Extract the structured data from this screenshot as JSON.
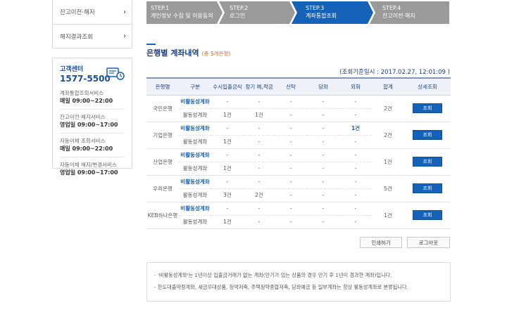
{
  "sidebar": {
    "menu": [
      {
        "label": "잔고이전·해지"
      },
      {
        "label": "해지결과조회"
      }
    ],
    "customer_center": {
      "title": "고객센터",
      "phone": "1577-5500",
      "services": [
        {
          "label": "계좌통합조회서비스",
          "time": "매일 09:00~22:00"
        },
        {
          "label": "잔고이전·해지서비스",
          "time": "영업일 09:00~17:00"
        },
        {
          "label": "자동이체 조회서비스",
          "time": "매일 09:00~22:00"
        },
        {
          "label": "자동이체 해지/변경서비스",
          "time": "영업일 09:00~17:00"
        }
      ]
    }
  },
  "steps": [
    {
      "num": "STEP.1",
      "name": "개인정보 수집 및 이용동의",
      "active": false
    },
    {
      "num": "STEP.2",
      "name": "로그인",
      "active": false
    },
    {
      "num": "STEP.3",
      "name": "계좌통합조회",
      "active": true
    },
    {
      "num": "STEP.4",
      "name": "잔고이전·해지",
      "active": false
    }
  ],
  "page": {
    "title": "은행별 계좌내역",
    "subtitle": "(총 5개은행)",
    "timestamp": "(조회기준일시 : 2017.02.27, 12:01:09 )"
  },
  "table": {
    "headers": [
      "은행명",
      "구분",
      "수시입출금식",
      "정기 예,적금",
      "신탁",
      "당좌",
      "외화",
      "합계",
      "상세조회"
    ],
    "view_label": "조회",
    "banks": [
      {
        "name": "국민은행",
        "total": "2건",
        "rows": [
          {
            "type": "비활동성계좌",
            "inactive": true,
            "cols": [
              "-",
              "-",
              "-",
              "-",
              "-"
            ]
          },
          {
            "type": "활동성계좌",
            "inactive": false,
            "cols": [
              "1건",
              "1건",
              "-",
              "-",
              "-"
            ]
          }
        ]
      },
      {
        "name": "기업은행",
        "total": "2건",
        "rows": [
          {
            "type": "비활동성계좌",
            "inactive": true,
            "cols": [
              "-",
              "-",
              "-",
              "-",
              "1건"
            ]
          },
          {
            "type": "활동성계좌",
            "inactive": false,
            "cols": [
              "1건",
              "-",
              "-",
              "-",
              "-"
            ]
          }
        ]
      },
      {
        "name": "산업은행",
        "total": "1건",
        "rows": [
          {
            "type": "비활동성계좌",
            "inactive": true,
            "cols": [
              "-",
              "-",
              "-",
              "-",
              "-"
            ]
          },
          {
            "type": "활동성계좌",
            "inactive": false,
            "cols": [
              "1건",
              "-",
              "-",
              "-",
              "-"
            ]
          }
        ]
      },
      {
        "name": "우리은행",
        "total": "5건",
        "rows": [
          {
            "type": "비활동성계좌",
            "inactive": true,
            "cols": [
              "-",
              "-",
              "-",
              "-",
              "-"
            ]
          },
          {
            "type": "활동성계좌",
            "inactive": false,
            "cols": [
              "3건",
              "2건",
              "-",
              "-",
              "-"
            ]
          }
        ]
      },
      {
        "name": "KEB하나은행",
        "total": "1건",
        "rows": [
          {
            "type": "비활동성계좌",
            "inactive": true,
            "cols": [
              "-",
              "-",
              "-",
              "-",
              "-"
            ]
          },
          {
            "type": "활동성계좌",
            "inactive": false,
            "cols": [
              "1건",
              "-",
              "-",
              "-",
              "-"
            ]
          }
        ]
      }
    ]
  },
  "actions": {
    "print": "인쇄하기",
    "logout": "로그아웃"
  },
  "notes": [
    "- '비활동성계좌'는 1년이상 입출금거래가 없는 계좌(만기가 있는 상품의 경우 만기 후 1년이 경과한 계좌)입니다.",
    "- 한도대출약정계좌, 세금우대상품, 청약저축, 주택청약종합저축, 당좌예금 등 일부계좌는 항상 활동성계좌로 분류됩니다."
  ],
  "colors": {
    "accent": "#1463b8",
    "step_inactive": "#9a9a9a",
    "subtitle": "#e0662a"
  }
}
